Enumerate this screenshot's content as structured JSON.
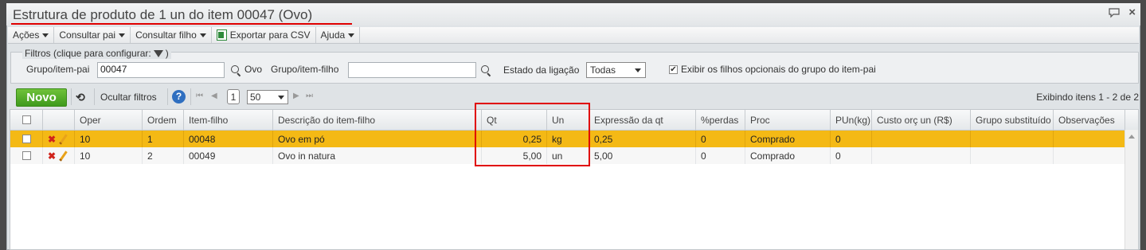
{
  "window": {
    "title": "Estrutura de produto de 1 un do item 00047 (Ovo)",
    "chat_icon": "chat-bubble-icon",
    "close_label": "×"
  },
  "menubar": {
    "acoes": "Ações",
    "consultar_pai": "Consultar pai",
    "consultar_filho": "Consultar filho",
    "exportar_csv": "Exportar para CSV",
    "ajuda": "Ajuda"
  },
  "filters": {
    "legend": "Filtros (clique para configurar:",
    "legend_close": ")",
    "grupo_pai_label": "Grupo/item-pai",
    "grupo_pai_value": "00047",
    "grupo_pai_desc": "Ovo",
    "grupo_filho_label": "Grupo/item-filho",
    "grupo_filho_value": "",
    "estado_label": "Estado da ligação",
    "estado_value": "Todas",
    "exibir_label": "Exibir os filhos opcionais do grupo do item-pai",
    "exibir_checked": true
  },
  "toolbar": {
    "novo": "Novo",
    "ocultar_filtros": "Ocultar filtros",
    "help": "?",
    "page": "1",
    "per_page": "50",
    "status": "Exibindo itens 1 - 2 de 2"
  },
  "grid": {
    "columns": [
      "Oper",
      "Ordem",
      "Item-filho",
      "Descrição do item-filho",
      "Qt",
      "Un",
      "Expressão da qt",
      "%perdas",
      "Proc",
      "PUn(kg)",
      "Custo orç un (R$)",
      "Grupo substituído",
      "Observações"
    ],
    "rows": [
      {
        "oper": "10",
        "ordem": "1",
        "item": "00048",
        "descricao": "Ovo em pó",
        "qt": "0,25",
        "un": "kg",
        "expressao": "0,25",
        "perdas": "0",
        "proc": "Comprado",
        "pun": "0",
        "custo": "",
        "grupo": "",
        "obs": ""
      },
      {
        "oper": "10",
        "ordem": "2",
        "item": "00049",
        "descricao": "Ovo in natura",
        "qt": "5,00",
        "un": "un",
        "expressao": "5,00",
        "perdas": "0",
        "proc": "Comprado",
        "pun": "0",
        "custo": "",
        "grupo": "",
        "obs": ""
      }
    ]
  },
  "colors": {
    "selected_row": "#f4b915",
    "novo_button": "#4caf27",
    "highlight": "#e00000"
  }
}
